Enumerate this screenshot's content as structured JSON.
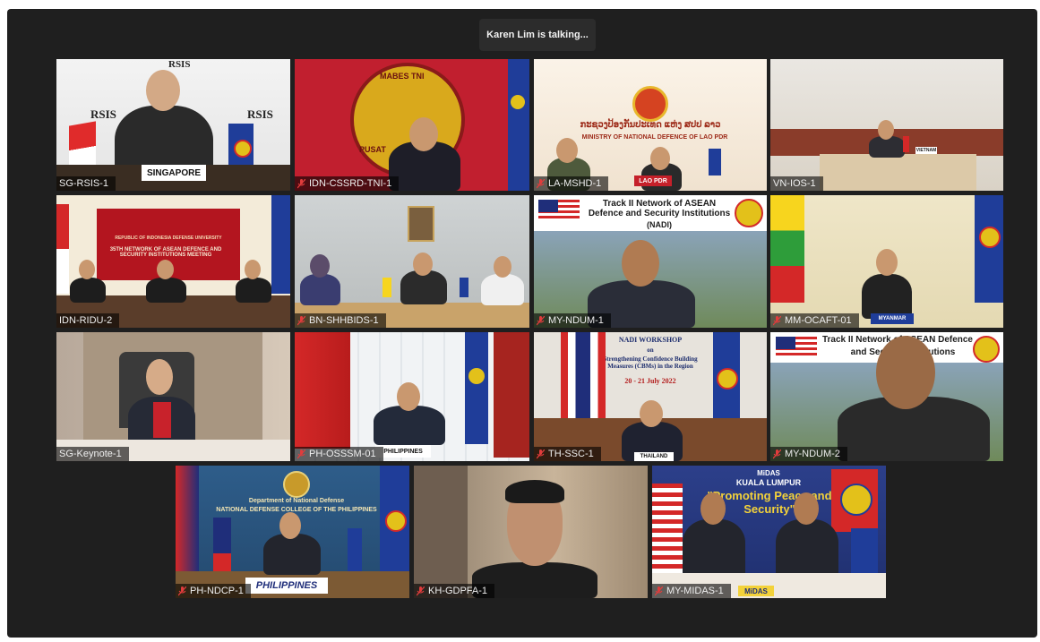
{
  "window": {
    "talking_status": "Karen Lim is talking..."
  },
  "tiles": [
    {
      "label": "SG-RSIS-1",
      "muted": false,
      "sign": "SINGAPORE",
      "banner1": "RSIS",
      "banner2": "RSIS",
      "banner3": "RSIS"
    },
    {
      "label": "IDN-CSSRD-TNI-1",
      "muted": true,
      "banner1": "MABES TNI",
      "banner2": "PUSAT"
    },
    {
      "label": "LA-MSHD-1",
      "muted": true,
      "sign": "LAO PDR",
      "banner1": "ກະຊວງປ້ອງກັນປະເທດ ແຫ່ງ ສປປ ລາວ",
      "banner2": "MINISTRY OF NATIONAL DEFENCE OF LAO PDR"
    },
    {
      "label": "VN-IOS-1",
      "muted": false,
      "sign": "VIETNAM"
    },
    {
      "label": "IDN-RIDU-2",
      "muted": false,
      "banner1": "REPUBLIC OF INDONESIA DEFENSE UNIVERSITY",
      "banner2": "35TH NETWORK OF ASEAN DEFENCE AND SECURITY INSTITUTIONS MEETING"
    },
    {
      "label": "BN-SHHBIDS-1",
      "muted": true
    },
    {
      "label": "MY-NDUM-1",
      "muted": true,
      "banner1": "Track II Network of ASEAN Defence and Security Institutions",
      "banner2": "(NADI)"
    },
    {
      "label": "MM-OCAFT-01",
      "muted": true,
      "sign": "MYANMAR"
    },
    {
      "label": "SG-Keynote-1",
      "muted": false
    },
    {
      "label": "PH-OSSSM-01",
      "muted": true,
      "sign": "PHILIPPINES"
    },
    {
      "label": "TH-SSC-1",
      "muted": true,
      "sign": "THAILAND",
      "banner1": "NADI WORKSHOP",
      "banner2": "on",
      "banner3": "Strengthening Confidence Building Measures (CBMs) in the Region",
      "banner4": "20 - 21 July 2022"
    },
    {
      "label": "MY-NDUM-2",
      "muted": true,
      "banner1": "Track II Network of ASEAN Defence",
      "banner2": "and Security Institutions"
    },
    {
      "label": "PH-NDCP-1",
      "muted": true,
      "sign": "PHILIPPINES",
      "banner1": "Department of National Defense",
      "banner2": "NATIONAL DEFENSE COLLEGE OF THE PHILIPPINES"
    },
    {
      "label": "KH-GDPFA-1",
      "muted": true
    },
    {
      "label": "MY-MIDAS-1",
      "muted": true,
      "sign": "MiDAS",
      "banner1": "MiDAS",
      "banner2": "KUALA LUMPUR",
      "banner3": "\"Promoting Peace and Security\""
    }
  ],
  "colors": {
    "muted_icon": "#e03c3c",
    "window_bg": "#1f1f1f",
    "label_bg": "rgba(0,0,0,0.6)"
  }
}
